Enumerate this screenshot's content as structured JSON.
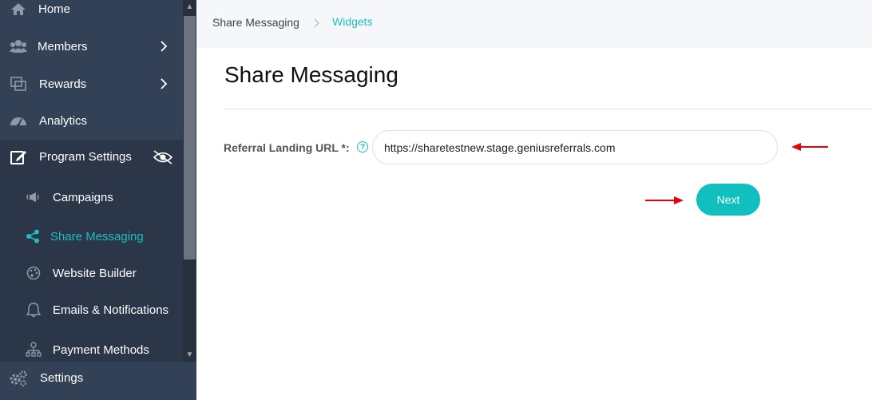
{
  "sidebar": {
    "items": [
      {
        "label": "Home",
        "icon": "home-icon"
      },
      {
        "label": "Members",
        "icon": "members-icon"
      },
      {
        "label": "Rewards",
        "icon": "rewards-icon"
      },
      {
        "label": "Analytics",
        "icon": "analytics-icon"
      },
      {
        "label": "Program Settings",
        "icon": "edit-icon"
      },
      {
        "label": "Campaigns",
        "icon": "campaigns-icon"
      },
      {
        "label": "Share Messaging",
        "icon": "share-icon"
      },
      {
        "label": "Website Builder",
        "icon": "palette-icon"
      },
      {
        "label": "Emails & Notifications",
        "icon": "bell-icon"
      },
      {
        "label": "Payment Methods",
        "icon": "payment-icon"
      },
      {
        "label": "Settings",
        "icon": "gears-icon"
      }
    ]
  },
  "breadcrumb": {
    "first": "Share Messaging",
    "second": "Widgets"
  },
  "page": {
    "title": "Share Messaging"
  },
  "form": {
    "label": "Referral Landing URL *:",
    "help": "?",
    "url_value": "https://sharetestnew.stage.geniusreferrals.com",
    "next_label": "Next"
  },
  "colors": {
    "accent": "#12bfbf",
    "sidebar": "#334156",
    "annotation": "#e8000b"
  }
}
